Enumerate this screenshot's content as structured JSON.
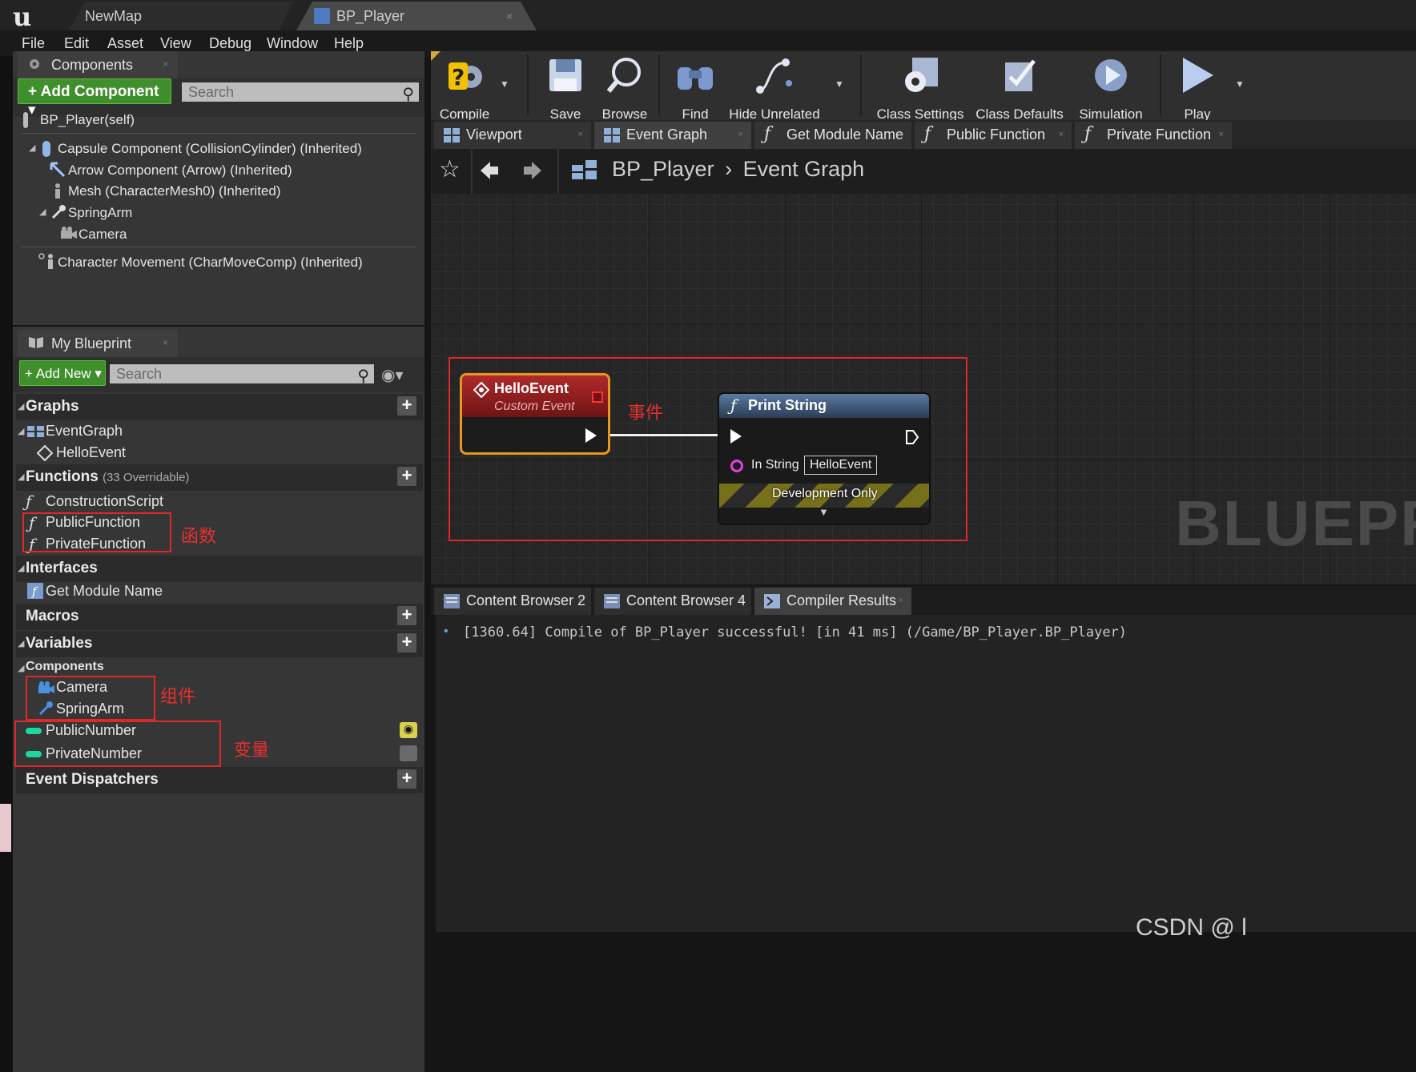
{
  "app": {
    "logo": "u",
    "doc_tabs": [
      "NewMap",
      "BP_Player"
    ],
    "tab_close": "×"
  },
  "menu": [
    "File",
    "Edit",
    "Asset",
    "View",
    "Debug",
    "Window",
    "Help"
  ],
  "components_panel": {
    "tab_label": "Components",
    "add_button": "+ Add Component ▾",
    "search_placeholder": "Search",
    "self_item": "BP_Player(self)",
    "items": [
      "Capsule Component (CollisionCylinder) (Inherited)",
      "Arrow Component (Arrow) (Inherited)",
      "Mesh (CharacterMesh0) (Inherited)",
      "SpringArm",
      "Camera",
      "Character Movement (CharMoveComp) (Inherited)"
    ]
  },
  "my_blueprint": {
    "tab_label": "My Blueprint",
    "add_button": "+ Add New ▾",
    "search_placeholder": "Search",
    "sections": {
      "graphs": "Graphs",
      "functions": "Functions",
      "functions_sub": "(33 Overridable)",
      "interfaces": "Interfaces",
      "macros": "Macros",
      "variables": "Variables",
      "components": "Components",
      "dispatchers": "Event Dispatchers"
    },
    "graphs_items": [
      "EventGraph",
      "HelloEvent"
    ],
    "function_items": [
      "ConstructionScript",
      "PublicFunction",
      "PrivateFunction"
    ],
    "interface_items": [
      "Get Module Name"
    ],
    "component_vars": [
      "Camera",
      "SpringArm"
    ],
    "variables": [
      "PublicNumber",
      "PrivateNumber"
    ],
    "plus": "+"
  },
  "annotations": {
    "event": "事件",
    "function": "函数",
    "component": "组件",
    "variable": "变量"
  },
  "toolbar": [
    "Compile",
    "Save",
    "Browse",
    "Find",
    "Hide Unrelated",
    "Class Settings",
    "Class Defaults",
    "Simulation",
    "Play"
  ],
  "graph_tabs": [
    "Viewport",
    "Event Graph",
    "Get Module Name",
    "Public Function",
    "Private Function"
  ],
  "breadcrumb": {
    "root": "BP_Player",
    "sep": "›",
    "leaf": "Event Graph"
  },
  "watermark": "BLUEPR",
  "nodes": {
    "event": {
      "title": "HelloEvent",
      "subtitle": "Custom Event"
    },
    "print": {
      "title": "Print String",
      "pin_label": "In String",
      "pin_value": "HelloEvent",
      "footer": "Development Only"
    }
  },
  "bottom_tabs": [
    "Content Browser 2",
    "Content Browser 4",
    "Compiler Results"
  ],
  "log": {
    "bullet": "•",
    "line": "[1360.64] Compile of BP_Player successful! [in 41 ms] (/Game/BP_Player.BP_Player)"
  },
  "watermark_footer": "CSDN @ l",
  "colors": {
    "accent_green": "#3f8f2c",
    "event_red": "#9e1b1b",
    "annotation_red": "#e02828",
    "node_orange": "#e8961e"
  }
}
